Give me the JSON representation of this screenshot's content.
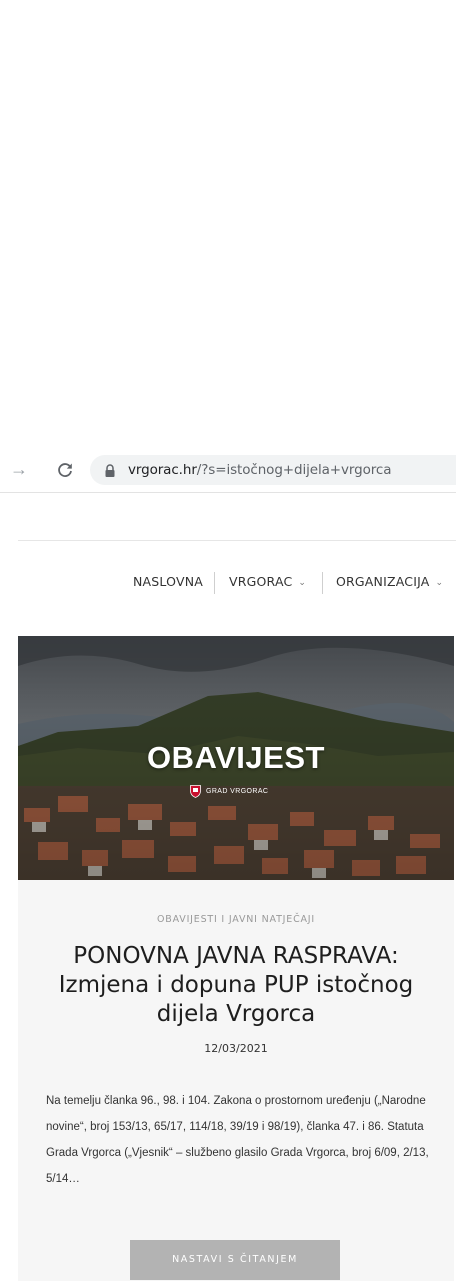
{
  "browser": {
    "url_host": "vrgorac.hr",
    "url_path": "/?s=istočnog+dijela+vrgorca"
  },
  "nav": {
    "items": [
      {
        "label": "NASLOVNA"
      },
      {
        "label": "VRGORAC"
      },
      {
        "label": "ORGANIZACIJA"
      }
    ]
  },
  "post": {
    "image_title": "OBAVIJEST",
    "image_logo_text": "GRAD VRGORAC",
    "category": "OBAVIJESTI I JAVNI NATJEČAJI",
    "title": "PONOVNA JAVNA RASPRAVA: Izmjena i dopuna PUP istočnog dijela Vrgorca",
    "date": "12/03/2021",
    "excerpt": "Na temelju članka 96., 98. i 104. Zakona o prostornom uređenju („Narodne novine“, broj 153/13, 65/17, 114/18, 39/19 i 98/19), članka 47. i 86. Statuta Grada Vrgorca („Vjesnik“ – službeno glasilo Grada Vrgorca, broj 6/09, 2/13, 5/14…",
    "read_more_label": "NASTAVI S ČITANJEM"
  },
  "icons": {
    "forward": "arrow-right-icon",
    "reload": "reload-icon",
    "lock": "lock-icon",
    "dropdown": "chevron-down-icon",
    "crest": "shield-crest-icon"
  },
  "colors": {
    "button_bg": "#b3b3b3",
    "card_bg": "#f6f6f6",
    "address_bar_bg": "#f1f3f4"
  }
}
